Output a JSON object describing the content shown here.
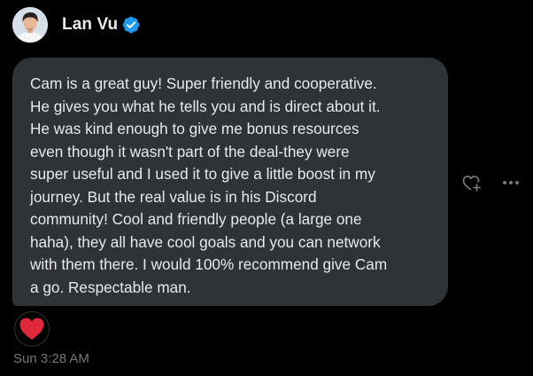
{
  "header": {
    "username": "Lan Vu",
    "avatar_icon": "user-avatar",
    "verified_icon": "verified-badge-icon"
  },
  "message": {
    "text": "Cam is a great guy! Super friendly and cooperative.\nHe gives you what he tells you and is direct about it.\nHe was kind enough to give me bonus resources\neven though it wasn't part of the deal-they were\nsuper useful and I used it to give a little boost in my\njourney. But the real value is in his Discord\ncommunity! Cool and friendly people (a large one\nhaha), they all have cool goals and you can network\nwith them there. I would 100% recommend give Cam\na go. Respectable man.",
    "timestamp": "Sun 3:28 AM",
    "reaction": "heart-reaction-icon"
  },
  "actions": {
    "react_icon": "heart-plus-icon",
    "more_icon": "more-icon"
  },
  "colors": {
    "background": "#000000",
    "bubble": "#2f3336",
    "text": "#e7e9ea",
    "muted": "#71767b",
    "verified": "#1d9bf0",
    "heart": "#f91880"
  }
}
